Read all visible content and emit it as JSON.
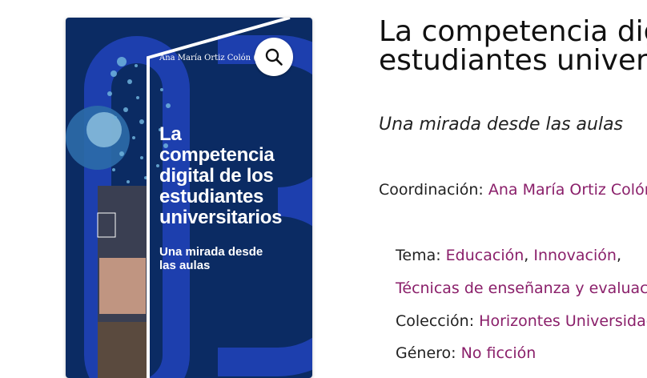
{
  "cover": {
    "author": "Ana María Ortiz Colón (coord.)",
    "title": "La competencia digital de los estudiantes universitarios",
    "subtitle": "Una mirada desde las aulas",
    "zoom_icon": "search-icon",
    "colors": {
      "background": "#0b2b63",
      "accent": "#1d3fae"
    }
  },
  "book": {
    "title_line1": "La competencia digital de los",
    "title_line2": "estudiantes universitarios",
    "subtitle": "Una mirada desde las aulas"
  },
  "meta": {
    "coordination_label": "Coordinación:",
    "coordination_value": "Ana María Ortiz Colón",
    "theme_label": "Tema:",
    "themes": [
      "Educación",
      "Innovación",
      "Técnicas de enseñanza y evaluación"
    ],
    "theme_separator": ",",
    "collection_label": "Colección:",
    "collection_value": "Horizontes Universidad",
    "genre_label": "Género:",
    "genre_value": "No ficción"
  },
  "colors": {
    "link": "#8a1f6a",
    "text": "#222222"
  }
}
